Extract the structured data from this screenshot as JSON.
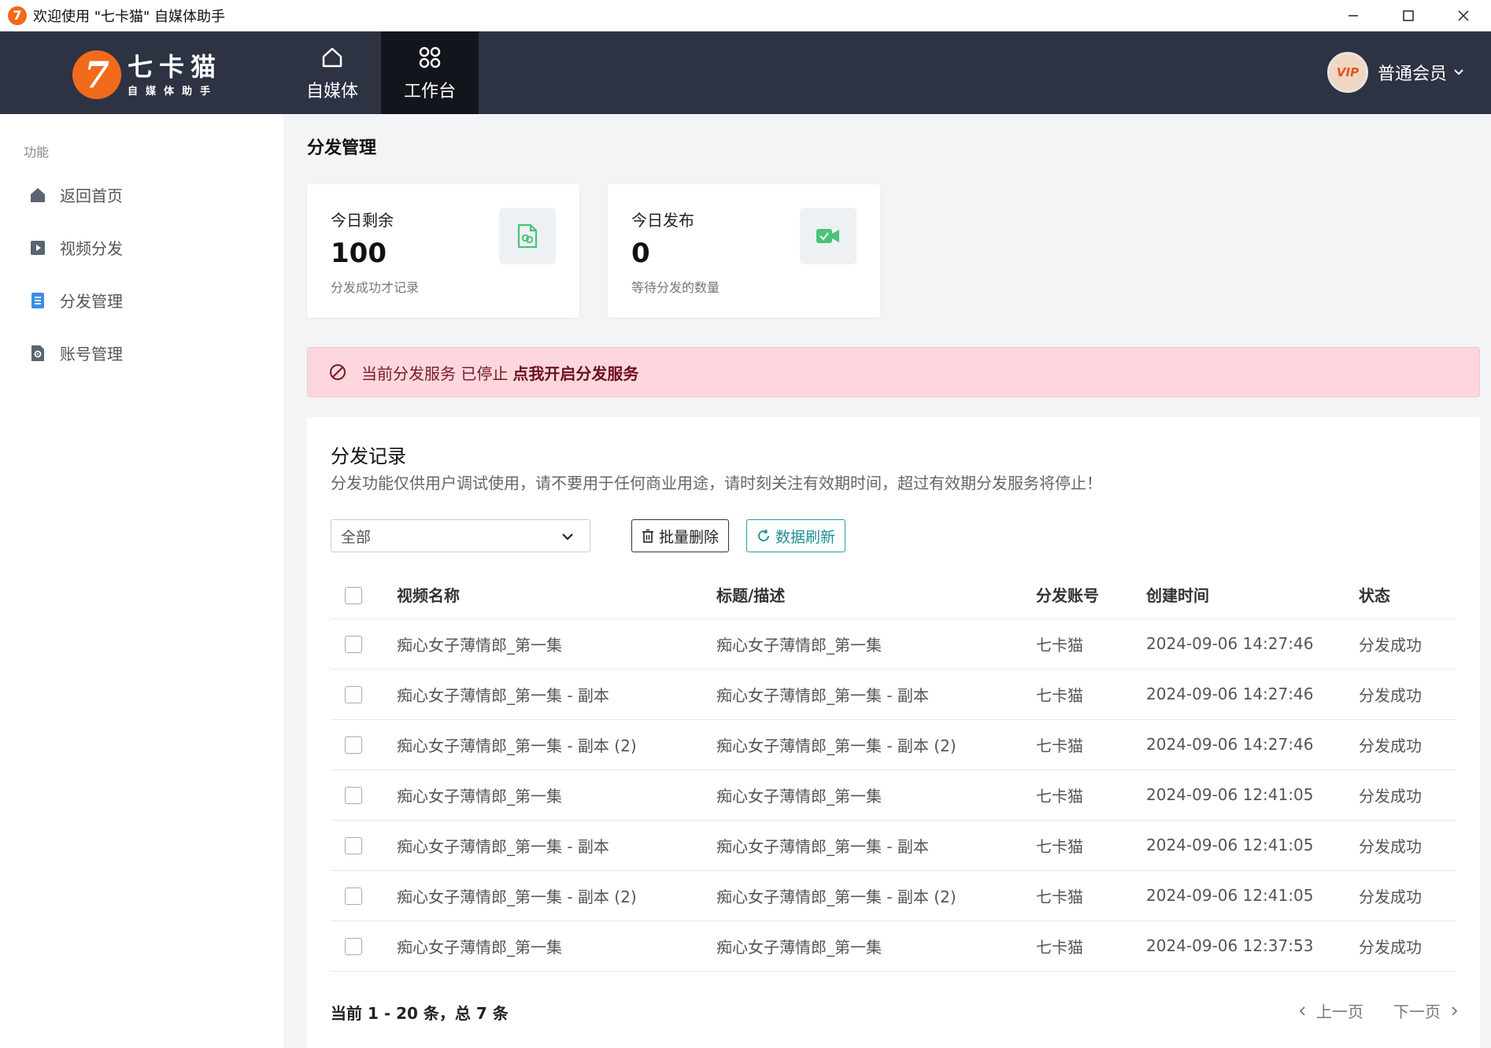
{
  "window": {
    "app_icon": "7",
    "title": "欢迎使用 \"七卡猫\" 自媒体助手",
    "icons": [
      "minimize-icon",
      "maximize-icon",
      "close-icon"
    ]
  },
  "logo": {
    "badge": "7",
    "name": "七卡猫",
    "subtitle": "自媒体助手"
  },
  "topnav": {
    "tabs": [
      {
        "label": "自媒体",
        "icon": "home-icon",
        "active": false
      },
      {
        "label": "工作台",
        "icon": "grid-icon",
        "active": true
      }
    ]
  },
  "user": {
    "badge": "VIP",
    "label": "普通会员"
  },
  "sidebar": {
    "section_title": "功能",
    "items": [
      {
        "label": "返回首页",
        "icon": "home-icon"
      },
      {
        "label": "视频分发",
        "icon": "play-icon"
      },
      {
        "label": "分发管理",
        "icon": "document-icon"
      },
      {
        "label": "账号管理",
        "icon": "settings-file-icon"
      }
    ]
  },
  "page": {
    "title": "分发管理"
  },
  "stats": [
    {
      "label": "今日剩余",
      "value": "100",
      "note": "分发成功才记录",
      "icon": "file-link-icon"
    },
    {
      "label": "今日发布",
      "value": "0",
      "note": "等待分发的数量",
      "icon": "video-camera-icon"
    }
  ],
  "alert": {
    "text": "当前分发服务 已停止",
    "link": "点我开启分发服务"
  },
  "records": {
    "title": "分发记录",
    "description": "分发功能仅供用户调试使用，请不要用于任何商业用途，请时刻关注有效期时间，超过有效期分发服务将停止！",
    "filter_value": "全部",
    "batch_delete": "批量删除",
    "refresh": "数据刷新",
    "columns": [
      "视频名称",
      "标题/描述",
      "分发账号",
      "创建时间",
      "状态"
    ],
    "rows": [
      {
        "name": "痴心女子薄情郎_第一集",
        "title": "痴心女子薄情郎_第一集",
        "account": "七卡猫",
        "time": "2024-09-06 14:27:46",
        "status": "分发成功"
      },
      {
        "name": "痴心女子薄情郎_第一集 - 副本",
        "title": "痴心女子薄情郎_第一集 - 副本",
        "account": "七卡猫",
        "time": "2024-09-06 14:27:46",
        "status": "分发成功"
      },
      {
        "name": "痴心女子薄情郎_第一集 - 副本 (2)",
        "title": "痴心女子薄情郎_第一集 - 副本 (2)",
        "account": "七卡猫",
        "time": "2024-09-06 14:27:46",
        "status": "分发成功"
      },
      {
        "name": "痴心女子薄情郎_第一集",
        "title": "痴心女子薄情郎_第一集",
        "account": "七卡猫",
        "time": "2024-09-06 12:41:05",
        "status": "分发成功"
      },
      {
        "name": "痴心女子薄情郎_第一集 - 副本",
        "title": "痴心女子薄情郎_第一集 - 副本",
        "account": "七卡猫",
        "time": "2024-09-06 12:41:05",
        "status": "分发成功"
      },
      {
        "name": "痴心女子薄情郎_第一集 - 副本 (2)",
        "title": "痴心女子薄情郎_第一集 - 副本 (2)",
        "account": "七卡猫",
        "time": "2024-09-06 12:41:05",
        "status": "分发成功"
      },
      {
        "name": "痴心女子薄情郎_第一集",
        "title": "痴心女子薄情郎_第一集",
        "account": "七卡猫",
        "time": "2024-09-06 12:37:53",
        "status": "分发成功"
      }
    ],
    "summary": "当前 1 - 20 条，总 7 条",
    "prev": "上一页",
    "next": "下一页"
  },
  "colors": {
    "topnav_bg": "#2d3343",
    "active_tab_bg": "#12151c",
    "brand_orange": "#f26a1b",
    "alert_bg": "#fdd7dd",
    "refresh_accent": "#22a0a8"
  }
}
